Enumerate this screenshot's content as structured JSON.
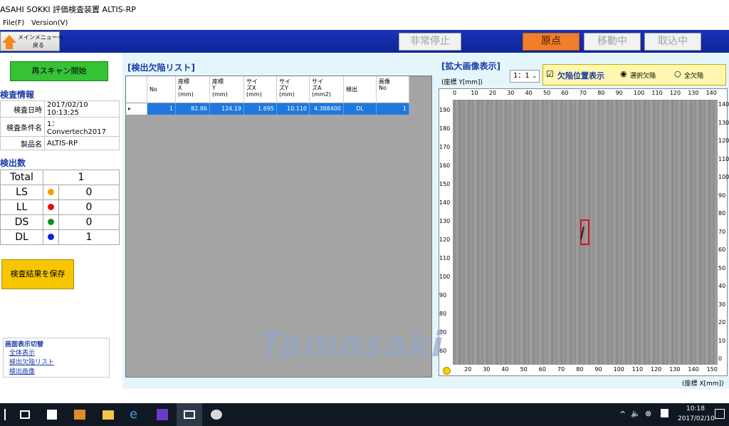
{
  "window": {
    "title": "ASAHI SOKKI 評価検査装置 ALTIS-RP"
  },
  "menu": {
    "file": "File(F)",
    "version": "Version(V)"
  },
  "toolbar": {
    "back_label": "メインメニューへ\n戻る",
    "emergency_stop": "非常停止",
    "origin": "原点",
    "moving": "移動中",
    "unloading": "取込中"
  },
  "left": {
    "rescan": "再スキャン開始",
    "inspection_info_title": "検査情報",
    "info": [
      {
        "key": "検査日時",
        "value": "2017/02/10 10:13:25"
      },
      {
        "key": "検査条件名",
        "value": "1：Convertech2017"
      },
      {
        "key": "製品名",
        "value": "ALTIS-RP"
      }
    ],
    "count_title": "検出数",
    "total_label": "Total",
    "total_value": "1",
    "counts": [
      {
        "label": "LS",
        "color": "#f5a000",
        "value": "0"
      },
      {
        "label": "LL",
        "color": "#e01010",
        "value": "0"
      },
      {
        "label": "DS",
        "color": "#1a8a1a",
        "value": "0"
      },
      {
        "label": "DL",
        "color": "#1020e0",
        "value": "1"
      }
    ],
    "save_results": "検査結果を保存",
    "view_switch_title": "画面表示切替",
    "view_links": [
      "全体表示",
      "検出欠陥リスト",
      "検出画像"
    ]
  },
  "list": {
    "title": "[検出欠陥リスト]",
    "headers": [
      "No",
      "座標\nX\n(mm)",
      "座標\nY\n(mm)",
      "サイ\nズX\n(mm)",
      "サイ\nズY\n(mm)",
      "サイ\nズA\n(mm2)",
      "検出",
      "画像\nNo"
    ],
    "row": [
      "1",
      "82.86",
      "124.19",
      "1.695",
      "10.110",
      "4.388400",
      "DL",
      "1"
    ]
  },
  "image": {
    "title": "[拡大画像表示]",
    "y_coord_label": "(座標 Y[mm])",
    "zoom": "1：1",
    "show_defect_pos": "欠陥位置表示",
    "opt_selected": "選択欠陥",
    "opt_all": "全欠陥",
    "top_ticks": [
      "0",
      "10",
      "20",
      "30",
      "40",
      "50",
      "60",
      "70",
      "80",
      "90",
      "100",
      "110",
      "120",
      "130",
      "140"
    ],
    "left_ticks": [
      "190",
      "180",
      "170",
      "160",
      "150",
      "140",
      "130",
      "120",
      "110",
      "100",
      "90",
      "80",
      "70",
      "60"
    ],
    "right_ticks": [
      "140",
      "130",
      "120",
      "110",
      "100",
      "90",
      "80",
      "70",
      "60",
      "50",
      "40",
      "30",
      "20",
      "10",
      "0"
    ],
    "bottom_ticks": [
      "20",
      "30",
      "40",
      "50",
      "60",
      "70",
      "80",
      "90",
      "100",
      "110",
      "120",
      "130",
      "140",
      "150"
    ],
    "x_coord_label": "(座標 X[mm])"
  },
  "watermark": "Tamasaki",
  "taskbar": {
    "time": "10:18",
    "date": "2017/02/10"
  }
}
